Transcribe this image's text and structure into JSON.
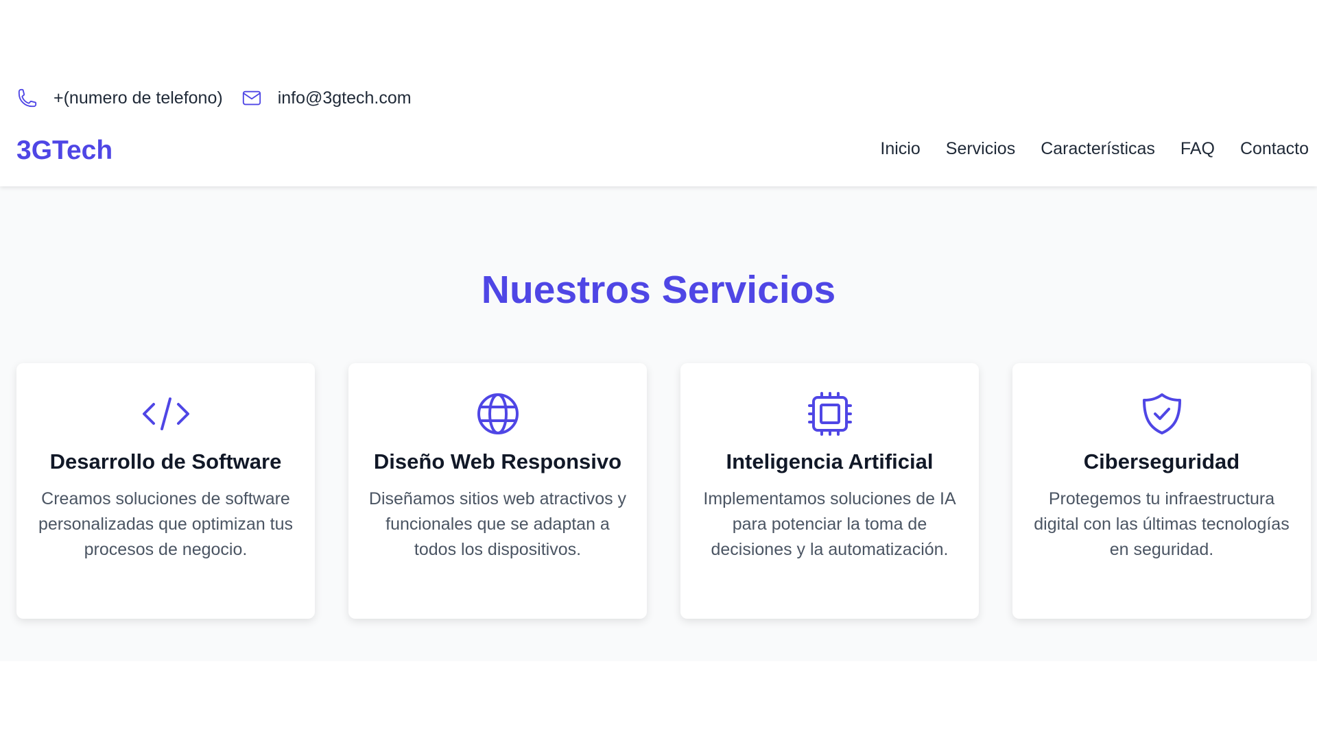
{
  "contact": {
    "phone": "+(numero de telefono)",
    "email": "info@3gtech.com"
  },
  "header": {
    "logo": "3GTech",
    "nav": [
      "Inicio",
      "Servicios",
      "Características",
      "FAQ",
      "Contacto"
    ]
  },
  "services": {
    "title": "Nuestros Servicios",
    "cards": [
      {
        "icon": "code-icon",
        "title": "Desarrollo de Software",
        "description": "Creamos soluciones de software personalizadas que optimizan tus procesos de negocio."
      },
      {
        "icon": "globe-icon",
        "title": "Diseño Web Responsivo",
        "description": "Diseñamos sitios web atractivos y funcionales que se adaptan a todos los dispositivos."
      },
      {
        "icon": "chip-icon",
        "title": "Inteligencia Artificial",
        "description": "Implementamos soluciones de IA para potenciar la toma de decisiones y la automatización."
      },
      {
        "icon": "shield-check-icon",
        "title": "Ciberseguridad",
        "description": "Protegemos tu infraestructura digital con las últimas tecnologías en seguridad."
      }
    ]
  },
  "colors": {
    "accent": "#4f46e5",
    "section_bg": "#f9fafb",
    "text": "#1f2937",
    "muted_text": "#4b5563"
  }
}
